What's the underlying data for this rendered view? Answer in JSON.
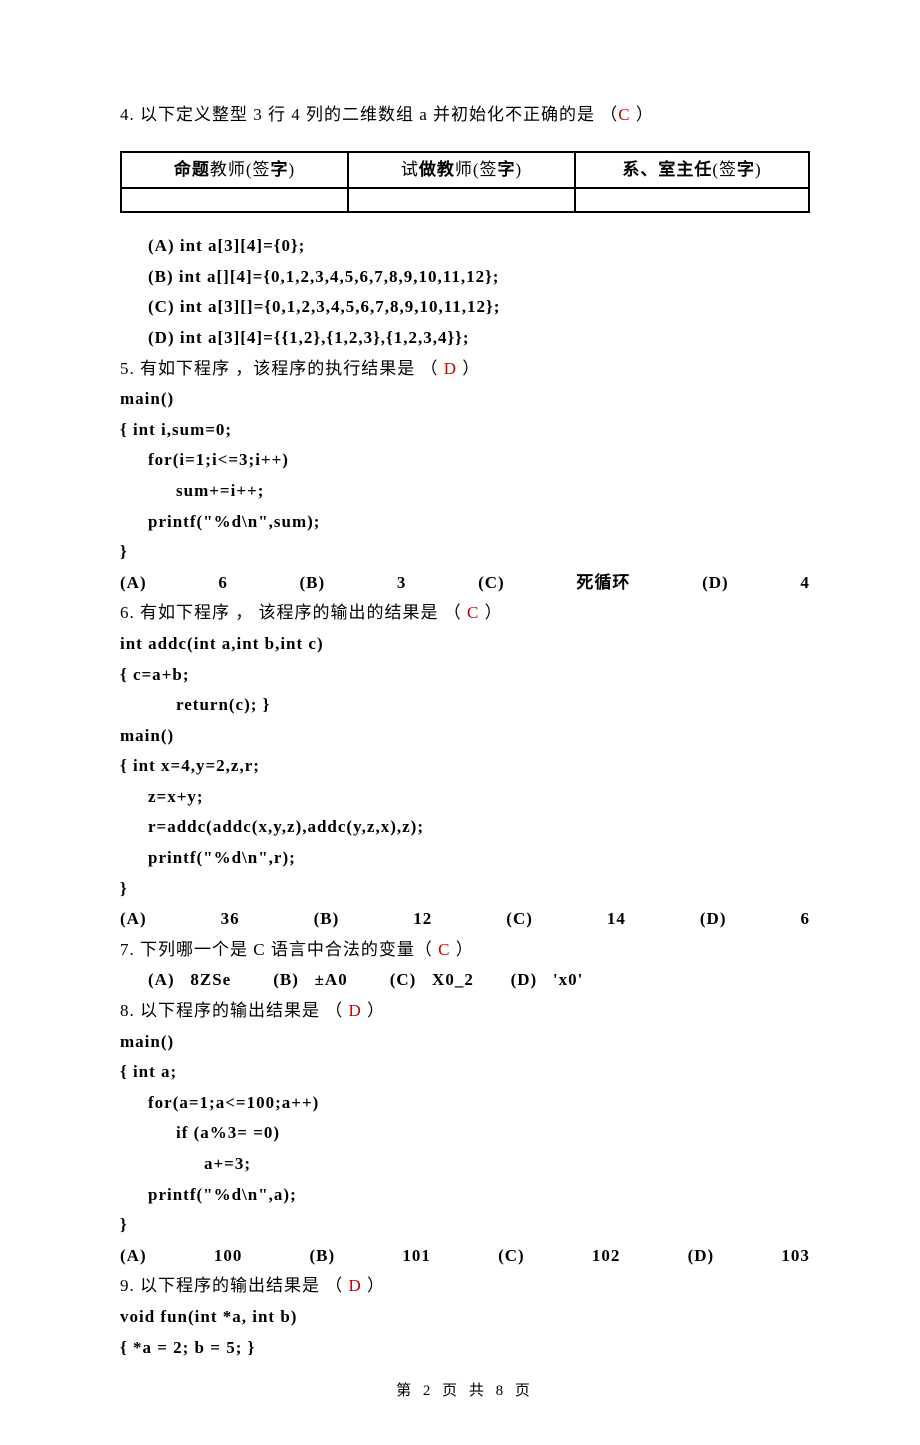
{
  "q4": {
    "text": "4.  以下定义整型  3 行 4 列的二维数组  a 并初始化不正确的是 （",
    "answer": "C",
    "tail": " ）",
    "optA": "(A) int a[3][4]={0};",
    "optB": "(B) int a[][4]={0,1,2,3,4,5,6,7,8,9,10,11,12};",
    "optC": "(C) int a[3][]={0,1,2,3,4,5,6,7,8,9,10,11,12};",
    "optD": "(D) int a[3][4]={{1,2},{1,2,3},{1,2,3,4}};"
  },
  "table": {
    "h1a": "命题",
    "h1b": "教师",
    "h1c": "(签",
    "h1d": "字",
    "h1e": ")",
    "h2a": "试",
    "h2b": "做教",
    "h2c": "师(签",
    "h2d": "字",
    "h2e": ")",
    "h3a": "系、室主任",
    "h3b": "(签",
    "h3c": "字",
    "h3d": ")"
  },
  "q5": {
    "text": "5. 有如下程序 ，该程序的执行结果是 （  ",
    "answer": "D",
    "tail": " ）",
    "code1": "main()",
    "code2": "{    int i,sum=0;",
    "code3": "for(i=1;i<=3;i++)",
    "code4": "sum+=i++;",
    "code5": "printf(\"%d\\n\",sum);",
    "code6": "}",
    "aA": "(A)",
    "aAv": "6",
    "aB": "(B)",
    "aBv": "3",
    "aC": "(C)",
    "aCv": "死循环",
    "aD": "(D)",
    "aDv": "4"
  },
  "q6": {
    "text": "6. 有如下程序 ， 该程序的输出的结果是 （ ",
    "answer": "C",
    "tail": "  ）",
    "code1": "int addc(int a,int b,int c)",
    "code2": "{        c=a+b;",
    "code3": "return(c); }",
    "code4": "main()",
    "code5": "{    int x=4,y=2,z,r;",
    "code6": "z=x+y;",
    "code7": "r=addc(addc(x,y,z),addc(y,z,x),z);",
    "code8": "printf(\"%d\\n\",r);",
    "code9": "}",
    "aA": "(A)",
    "aAv": "36",
    "aB": "(B)",
    "aBv": "12",
    "aC": "(C)",
    "aCv": "14",
    "aD": "(D)",
    "aDv": "6"
  },
  "q7": {
    "text": "7.  下列哪一个是 C 语言中合法的变量（ ",
    "answer": "C",
    "tail": " ）",
    "opts": "(A)   8ZSe        (B)   ±A0        (C)   X0_2       (D)   'x0'"
  },
  "q8": {
    "text": "8. 以下程序的输出结果是 （ ",
    "answer": "D",
    "tail": " ）",
    "code1": "main()",
    "code2": "{    int a;",
    "code3": "for(a=1;a<=100;a++)",
    "code4": "if (a%3= =0)",
    "code5": "a+=3;",
    "code6": "printf(\"%d\\n\",a);",
    "code7": "}",
    "aA": "(A)",
    "aAv": "100",
    "aB": "(B)",
    "aBv": "101",
    "aC": "(C)",
    "aCv": "102",
    "aD": "(D)",
    "aDv": "103"
  },
  "q9": {
    "text": "9. 以下程序的输出结果是 （  ",
    "answer": "D",
    "tail": " ）",
    "code1": "void fun(int *a, int b)",
    "code2": "{     *a = 2; b = 5;    }"
  },
  "footer": "第 2 页 共 8 页"
}
